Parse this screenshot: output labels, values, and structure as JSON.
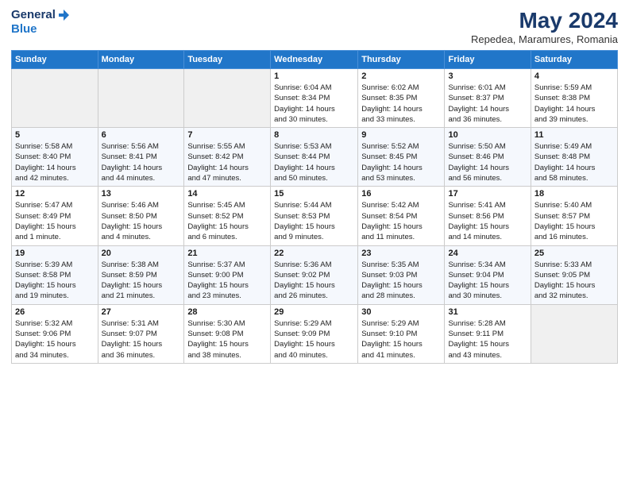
{
  "header": {
    "logo": {
      "general": "General",
      "blue": "Blue",
      "icon": "▶"
    },
    "title": "May 2024",
    "location": "Repedea, Maramures, Romania"
  },
  "weekdays": [
    "Sunday",
    "Monday",
    "Tuesday",
    "Wednesday",
    "Thursday",
    "Friday",
    "Saturday"
  ],
  "weeks": [
    [
      {
        "day": "",
        "info": ""
      },
      {
        "day": "",
        "info": ""
      },
      {
        "day": "",
        "info": ""
      },
      {
        "day": "1",
        "info": "Sunrise: 6:04 AM\nSunset: 8:34 PM\nDaylight: 14 hours\nand 30 minutes."
      },
      {
        "day": "2",
        "info": "Sunrise: 6:02 AM\nSunset: 8:35 PM\nDaylight: 14 hours\nand 33 minutes."
      },
      {
        "day": "3",
        "info": "Sunrise: 6:01 AM\nSunset: 8:37 PM\nDaylight: 14 hours\nand 36 minutes."
      },
      {
        "day": "4",
        "info": "Sunrise: 5:59 AM\nSunset: 8:38 PM\nDaylight: 14 hours\nand 39 minutes."
      }
    ],
    [
      {
        "day": "5",
        "info": "Sunrise: 5:58 AM\nSunset: 8:40 PM\nDaylight: 14 hours\nand 42 minutes."
      },
      {
        "day": "6",
        "info": "Sunrise: 5:56 AM\nSunset: 8:41 PM\nDaylight: 14 hours\nand 44 minutes."
      },
      {
        "day": "7",
        "info": "Sunrise: 5:55 AM\nSunset: 8:42 PM\nDaylight: 14 hours\nand 47 minutes."
      },
      {
        "day": "8",
        "info": "Sunrise: 5:53 AM\nSunset: 8:44 PM\nDaylight: 14 hours\nand 50 minutes."
      },
      {
        "day": "9",
        "info": "Sunrise: 5:52 AM\nSunset: 8:45 PM\nDaylight: 14 hours\nand 53 minutes."
      },
      {
        "day": "10",
        "info": "Sunrise: 5:50 AM\nSunset: 8:46 PM\nDaylight: 14 hours\nand 56 minutes."
      },
      {
        "day": "11",
        "info": "Sunrise: 5:49 AM\nSunset: 8:48 PM\nDaylight: 14 hours\nand 58 minutes."
      }
    ],
    [
      {
        "day": "12",
        "info": "Sunrise: 5:47 AM\nSunset: 8:49 PM\nDaylight: 15 hours\nand 1 minute."
      },
      {
        "day": "13",
        "info": "Sunrise: 5:46 AM\nSunset: 8:50 PM\nDaylight: 15 hours\nand 4 minutes."
      },
      {
        "day": "14",
        "info": "Sunrise: 5:45 AM\nSunset: 8:52 PM\nDaylight: 15 hours\nand 6 minutes."
      },
      {
        "day": "15",
        "info": "Sunrise: 5:44 AM\nSunset: 8:53 PM\nDaylight: 15 hours\nand 9 minutes."
      },
      {
        "day": "16",
        "info": "Sunrise: 5:42 AM\nSunset: 8:54 PM\nDaylight: 15 hours\nand 11 minutes."
      },
      {
        "day": "17",
        "info": "Sunrise: 5:41 AM\nSunset: 8:56 PM\nDaylight: 15 hours\nand 14 minutes."
      },
      {
        "day": "18",
        "info": "Sunrise: 5:40 AM\nSunset: 8:57 PM\nDaylight: 15 hours\nand 16 minutes."
      }
    ],
    [
      {
        "day": "19",
        "info": "Sunrise: 5:39 AM\nSunset: 8:58 PM\nDaylight: 15 hours\nand 19 minutes."
      },
      {
        "day": "20",
        "info": "Sunrise: 5:38 AM\nSunset: 8:59 PM\nDaylight: 15 hours\nand 21 minutes."
      },
      {
        "day": "21",
        "info": "Sunrise: 5:37 AM\nSunset: 9:00 PM\nDaylight: 15 hours\nand 23 minutes."
      },
      {
        "day": "22",
        "info": "Sunrise: 5:36 AM\nSunset: 9:02 PM\nDaylight: 15 hours\nand 26 minutes."
      },
      {
        "day": "23",
        "info": "Sunrise: 5:35 AM\nSunset: 9:03 PM\nDaylight: 15 hours\nand 28 minutes."
      },
      {
        "day": "24",
        "info": "Sunrise: 5:34 AM\nSunset: 9:04 PM\nDaylight: 15 hours\nand 30 minutes."
      },
      {
        "day": "25",
        "info": "Sunrise: 5:33 AM\nSunset: 9:05 PM\nDaylight: 15 hours\nand 32 minutes."
      }
    ],
    [
      {
        "day": "26",
        "info": "Sunrise: 5:32 AM\nSunset: 9:06 PM\nDaylight: 15 hours\nand 34 minutes."
      },
      {
        "day": "27",
        "info": "Sunrise: 5:31 AM\nSunset: 9:07 PM\nDaylight: 15 hours\nand 36 minutes."
      },
      {
        "day": "28",
        "info": "Sunrise: 5:30 AM\nSunset: 9:08 PM\nDaylight: 15 hours\nand 38 minutes."
      },
      {
        "day": "29",
        "info": "Sunrise: 5:29 AM\nSunset: 9:09 PM\nDaylight: 15 hours\nand 40 minutes."
      },
      {
        "day": "30",
        "info": "Sunrise: 5:29 AM\nSunset: 9:10 PM\nDaylight: 15 hours\nand 41 minutes."
      },
      {
        "day": "31",
        "info": "Sunrise: 5:28 AM\nSunset: 9:11 PM\nDaylight: 15 hours\nand 43 minutes."
      },
      {
        "day": "",
        "info": ""
      }
    ]
  ]
}
